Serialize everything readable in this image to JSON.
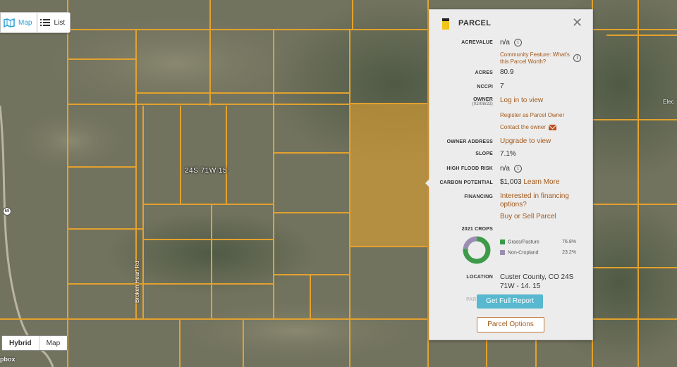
{
  "map": {
    "section_label": "24S 71W 15",
    "road_label": "Broken Heart Rd",
    "road_label_right": "Elec",
    "highway_shield": "69",
    "attribution": "pbox",
    "view_toggle": {
      "map_label": "Map",
      "list_label": "List",
      "active": "Map"
    },
    "base_layers": {
      "hybrid_label": "Hybrid",
      "map_label": "Map",
      "active": "Hybrid"
    },
    "colors": {
      "parcel_line": "#e3a12e",
      "selected_fill": "#e3a12e",
      "terrain": "#6f705c"
    }
  },
  "panel": {
    "title": "PARCEL",
    "icon": "parcel-tag-icon",
    "close_icon": "close-icon",
    "rows": {
      "acrevalue": {
        "label": "ACREVALUE",
        "value": "n/a"
      },
      "community": {
        "link": "Community Feature: What's this Parcel Worth?"
      },
      "acres": {
        "label": "ACRES",
        "value": "80.9"
      },
      "nccpi": {
        "label": "NCCPI",
        "value": "7"
      },
      "owner": {
        "label": "OWNER",
        "sublabel": "(02/08/22)",
        "link": "Log in to view",
        "register": "Register as Parcel Owner",
        "contact": "Contact the owner"
      },
      "owner_address": {
        "label": "OWNER ADDRESS",
        "link": "Upgrade to view"
      },
      "slope": {
        "label": "SLOPE",
        "value": "7.1%"
      },
      "flood": {
        "label": "HIGH FLOOD RISK",
        "value": "n/a"
      },
      "carbon": {
        "label": "CARBON POTENTIAL",
        "value": "$1,003",
        "link": "Learn More"
      },
      "financing": {
        "label": "FINANCING",
        "link": "Interested in financing options?",
        "link2": "Buy or Sell Parcel"
      },
      "crops": {
        "label": "2021 CROPS",
        "items": [
          {
            "name": "Grass/Pasture",
            "pct": "76.8%",
            "value": 76.8,
            "color": "#3d9a48"
          },
          {
            "name": "Non-Cropland",
            "pct": "23.2%",
            "value": 23.2,
            "color": "#9a8fb3"
          }
        ]
      },
      "location": {
        "label": "LOCATION",
        "value": "Custer County, CO 24S 71W - 14, 15"
      }
    },
    "faded_label": "PAR",
    "report_button": "Get Full Report",
    "options_button": "Parcel Options"
  }
}
